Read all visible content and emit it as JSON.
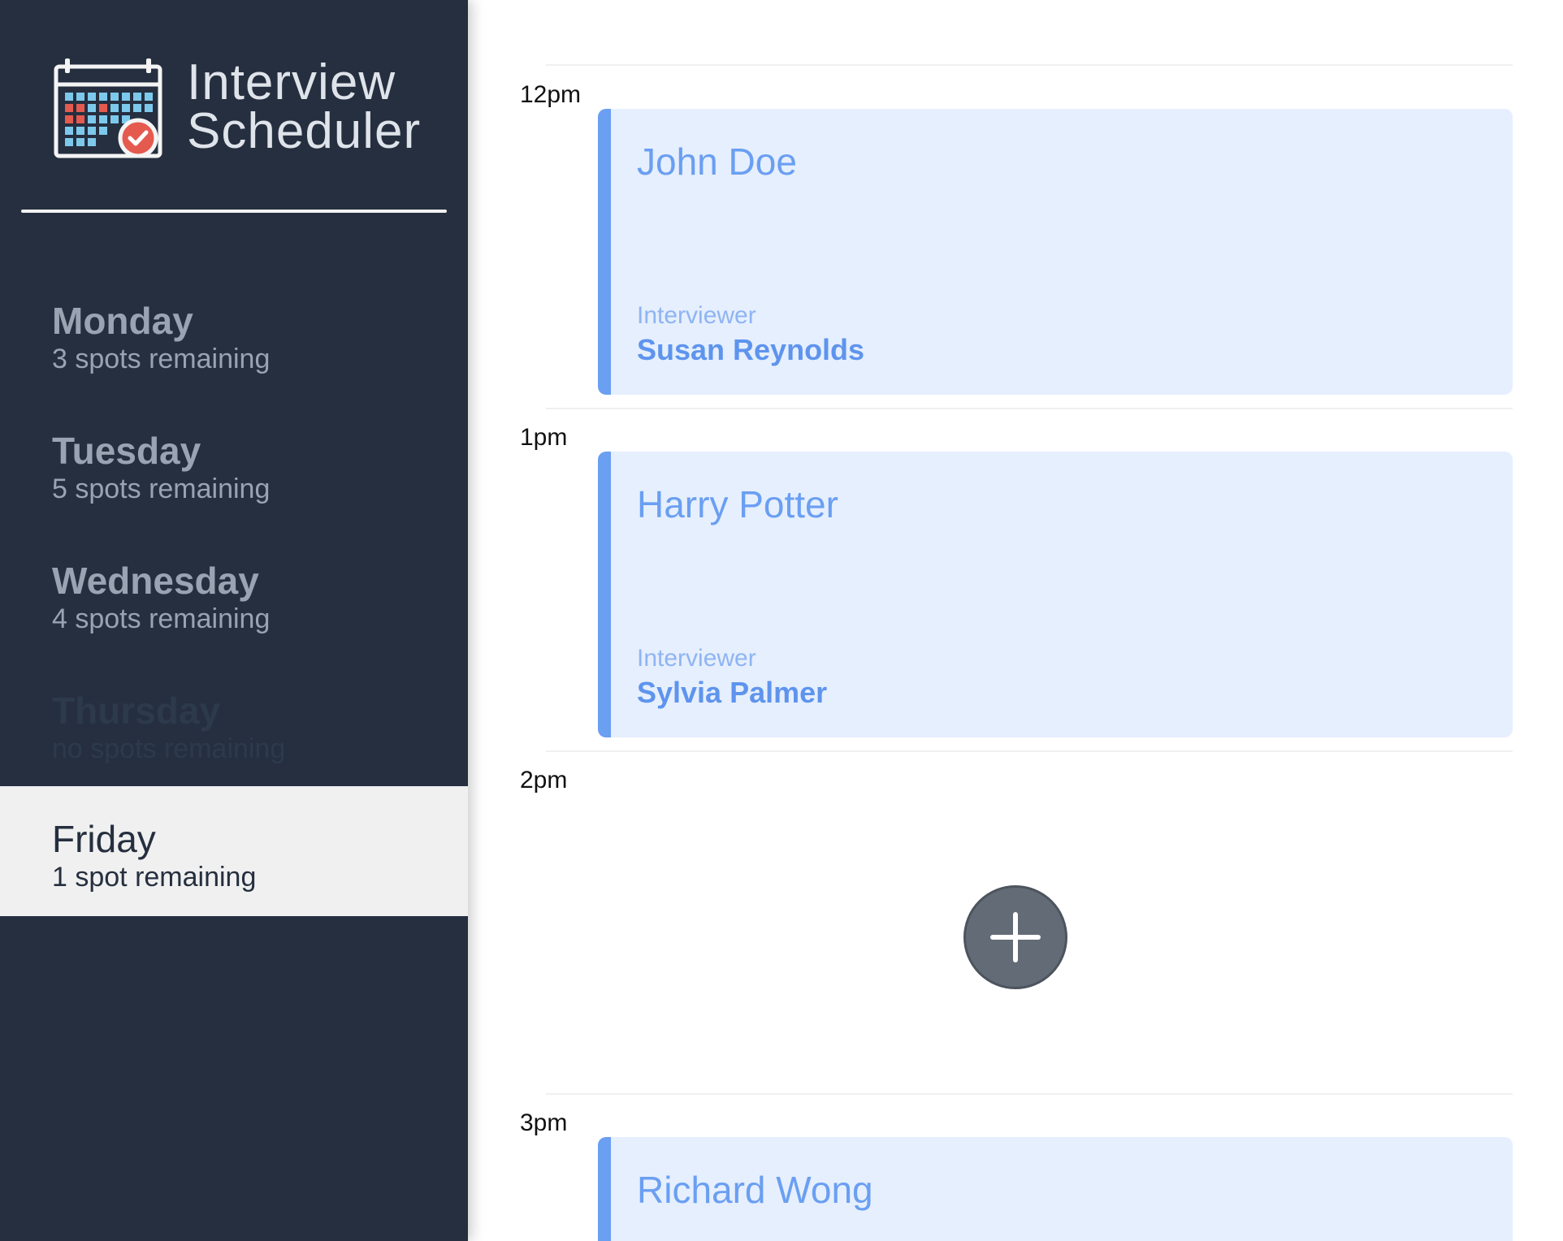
{
  "app": {
    "title_line1": "Interview",
    "title_line2": "Scheduler",
    "logo_icon": "calendar-check-icon"
  },
  "days": [
    {
      "name": "Monday",
      "spots": "3 spots remaining",
      "state": "normal"
    },
    {
      "name": "Tuesday",
      "spots": "5 spots remaining",
      "state": "normal"
    },
    {
      "name": "Wednesday",
      "spots": "4 spots remaining",
      "state": "normal"
    },
    {
      "name": "Thursday",
      "spots": "no spots remaining",
      "state": "full"
    },
    {
      "name": "Friday",
      "spots": "1 spot remaining",
      "state": "selected"
    }
  ],
  "schedule": {
    "times": [
      "12pm",
      "1pm",
      "2pm",
      "3pm"
    ],
    "appointments": [
      {
        "time": "12pm",
        "student": "John Doe",
        "interviewer_label": "Interviewer",
        "interviewer": "Susan Reynolds"
      },
      {
        "time": "1pm",
        "student": "Harry Potter",
        "interviewer_label": "Interviewer",
        "interviewer": "Sylvia Palmer"
      },
      {
        "time": "3pm",
        "student": "Richard Wong"
      }
    ],
    "empty_slot": {
      "time": "2pm",
      "add_icon": "plus-icon"
    }
  },
  "colors": {
    "sidebar_bg": "#252f3f",
    "appointment_bg": "#e6effd",
    "appointment_accent": "#6a9ff2",
    "add_button": "#636b76"
  }
}
